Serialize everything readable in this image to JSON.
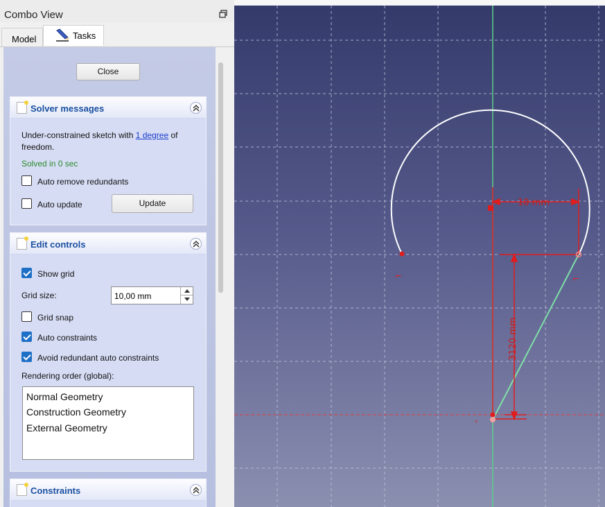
{
  "combo_view": {
    "title": "Combo View",
    "tabs": [
      {
        "label": "Model"
      },
      {
        "label": "Tasks"
      }
    ],
    "close_button": "Close"
  },
  "solver_messages": {
    "title": "Solver messages",
    "message_prefix": "Under-constrained sketch with ",
    "message_link": "1 degree",
    "message_suffix_1": " of",
    "message_suffix_2": "freedom.",
    "solved_status": "Solved in 0 sec",
    "auto_remove_redundants": {
      "label": "Auto remove redundants",
      "checked": false
    },
    "auto_update": {
      "label": "Auto update",
      "checked": false
    },
    "update_button": "Update",
    "status_color": "#2a8a2a"
  },
  "edit_controls": {
    "title": "Edit controls",
    "show_grid": {
      "label": "Show grid",
      "checked": true
    },
    "grid_size_label": "Grid size:",
    "grid_size_value": "10,00 mm",
    "grid_snap": {
      "label": "Grid snap",
      "checked": false
    },
    "auto_constraints": {
      "label": "Auto constraints",
      "checked": true
    },
    "avoid_redundant": {
      "label": "Avoid redundant auto constraints",
      "checked": true
    },
    "rendering_order_label": "Rendering order (global):",
    "rendering_order": [
      "Normal Geometry",
      "Construction Geometry",
      "External Geometry"
    ]
  },
  "constraints": {
    "title": "Constraints"
  },
  "sketch_view": {
    "horizontal_dimension": "10 mm",
    "vertical_dimension_overlap": "3120 mm",
    "colors": {
      "geometry": "#ffffff",
      "constraint": "#e01c1c",
      "axis_vertical": "#5ed08a",
      "axis_horizontal": "#e04040"
    }
  }
}
